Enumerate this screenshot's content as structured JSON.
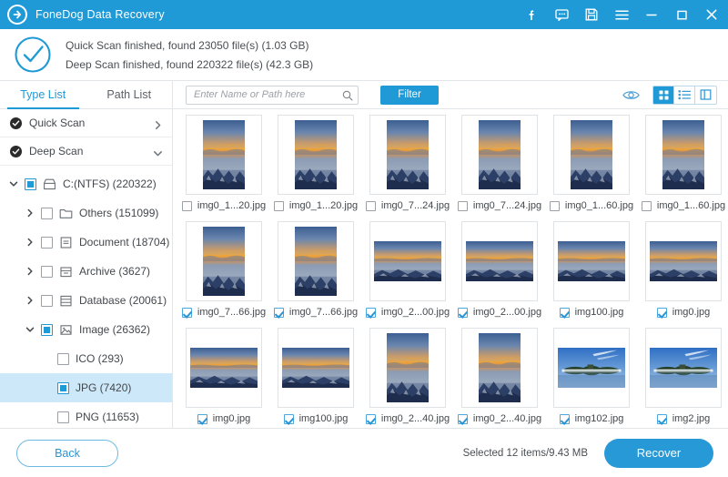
{
  "titlebar": {
    "app_title": "FoneDog Data Recovery",
    "logo_icon": "arrow-circle-logo",
    "icons": [
      {
        "name": "facebook-icon",
        "glyph": "f"
      },
      {
        "name": "feedback-chat-icon",
        "glyph": "chat"
      },
      {
        "name": "save-icon",
        "glyph": "floppy"
      },
      {
        "name": "menu-icon",
        "glyph": "hamburger"
      },
      {
        "name": "minimize-icon",
        "glyph": "minimize"
      },
      {
        "name": "maximize-icon",
        "glyph": "maximize"
      },
      {
        "name": "close-icon",
        "glyph": "close"
      }
    ]
  },
  "scan_status": {
    "check_icon": "circle-check-icon",
    "line1": "Quick Scan finished, found 23050 file(s) (1.03 GB)",
    "line2": "Deep Scan finished, found 220322 file(s) (42.3 GB)"
  },
  "sidebar": {
    "tabs": [
      {
        "label": "Type List",
        "active": true
      },
      {
        "label": "Path List",
        "active": false
      }
    ],
    "scan_rows": [
      {
        "label": "Quick Scan",
        "expanded": false,
        "icon": "check-circle-icon"
      },
      {
        "label": "Deep Scan",
        "expanded": true,
        "icon": "check-circle-icon"
      }
    ],
    "tree": [
      {
        "label": "C:(NTFS) (220322)",
        "icon": "drive-icon",
        "indent": 0,
        "arrow": "down",
        "check": "filled",
        "selected": false
      },
      {
        "label": "Others (151099)",
        "icon": "folder-icon",
        "indent": 1,
        "arrow": "right",
        "check": "empty",
        "selected": false
      },
      {
        "label": "Document (18704)",
        "icon": "document-icon",
        "indent": 1,
        "arrow": "right",
        "check": "empty",
        "selected": false
      },
      {
        "label": "Archive (3627)",
        "icon": "archive-icon",
        "indent": 1,
        "arrow": "right",
        "check": "empty",
        "selected": false
      },
      {
        "label": "Database (20061)",
        "icon": "database-icon",
        "indent": 1,
        "arrow": "right",
        "check": "empty",
        "selected": false
      },
      {
        "label": "Image (26362)",
        "icon": "image-icon",
        "indent": 1,
        "arrow": "down",
        "check": "filled",
        "selected": false
      },
      {
        "label": "ICO (293)",
        "icon": "none",
        "indent": 2,
        "arrow": "none",
        "check": "empty",
        "selected": false
      },
      {
        "label": "JPG (7420)",
        "icon": "none",
        "indent": 2,
        "arrow": "none",
        "check": "filled",
        "selected": true
      },
      {
        "label": "PNG (11653)",
        "icon": "none",
        "indent": 2,
        "arrow": "none",
        "check": "empty",
        "selected": false
      }
    ]
  },
  "toolbar": {
    "search_placeholder": "Enter Name or Path here",
    "search_value": "",
    "search_icon": "search-icon",
    "filter_label": "Filter",
    "preview_icon": "eye-icon",
    "views": [
      {
        "name": "grid-view",
        "icon": "grid-icon",
        "active": true
      },
      {
        "name": "list-view",
        "icon": "list-icon",
        "active": false
      },
      {
        "name": "split-view",
        "icon": "split-pane-icon",
        "active": false
      }
    ]
  },
  "files": {
    "rows": [
      [
        {
          "name": "img0_1...20.jpg",
          "checked": false,
          "orient": "portrait",
          "scene": "sunset"
        },
        {
          "name": "img0_1...20.jpg",
          "checked": false,
          "orient": "portrait",
          "scene": "sunset"
        },
        {
          "name": "img0_7...24.jpg",
          "checked": false,
          "orient": "portrait",
          "scene": "sunset"
        },
        {
          "name": "img0_7...24.jpg",
          "checked": false,
          "orient": "portrait",
          "scene": "sunset"
        },
        {
          "name": "img0_1...60.jpg",
          "checked": false,
          "orient": "portrait",
          "scene": "sunset"
        },
        {
          "name": "img0_1...60.jpg",
          "checked": false,
          "orient": "portrait",
          "scene": "sunset"
        }
      ],
      [
        {
          "name": "img0_7...66.jpg",
          "checked": true,
          "orient": "portrait",
          "scene": "sunset"
        },
        {
          "name": "img0_7...66.jpg",
          "checked": true,
          "orient": "portrait",
          "scene": "sunset"
        },
        {
          "name": "img0_2...00.jpg",
          "checked": true,
          "orient": "landscape",
          "scene": "sunset"
        },
        {
          "name": "img0_2...00.jpg",
          "checked": true,
          "orient": "landscape",
          "scene": "sunset"
        },
        {
          "name": "img100.jpg",
          "checked": true,
          "orient": "landscape",
          "scene": "sunset"
        },
        {
          "name": "img0.jpg",
          "checked": true,
          "orient": "landscape",
          "scene": "sunset"
        }
      ],
      [
        {
          "name": "img0.jpg",
          "checked": true,
          "orient": "landscape",
          "scene": "sunset"
        },
        {
          "name": "img100.jpg",
          "checked": true,
          "orient": "landscape",
          "scene": "sunset"
        },
        {
          "name": "img0_2...40.jpg",
          "checked": true,
          "orient": "portrait",
          "scene": "sunset"
        },
        {
          "name": "img0_2...40.jpg",
          "checked": true,
          "orient": "portrait",
          "scene": "sunset"
        },
        {
          "name": "img102.jpg",
          "checked": true,
          "orient": "landscape",
          "scene": "island"
        },
        {
          "name": "img2.jpg",
          "checked": true,
          "orient": "landscape",
          "scene": "island"
        }
      ]
    ]
  },
  "footer": {
    "back_label": "Back",
    "selection_info": "Selected 12 items/9.43 MB",
    "recover_label": "Recover"
  },
  "colors": {
    "brand_blue": "#1f9ad6",
    "header_blue": "#1f9ad6",
    "selection_blue": "#cde8f8",
    "recover_blue": "#2699d6"
  }
}
